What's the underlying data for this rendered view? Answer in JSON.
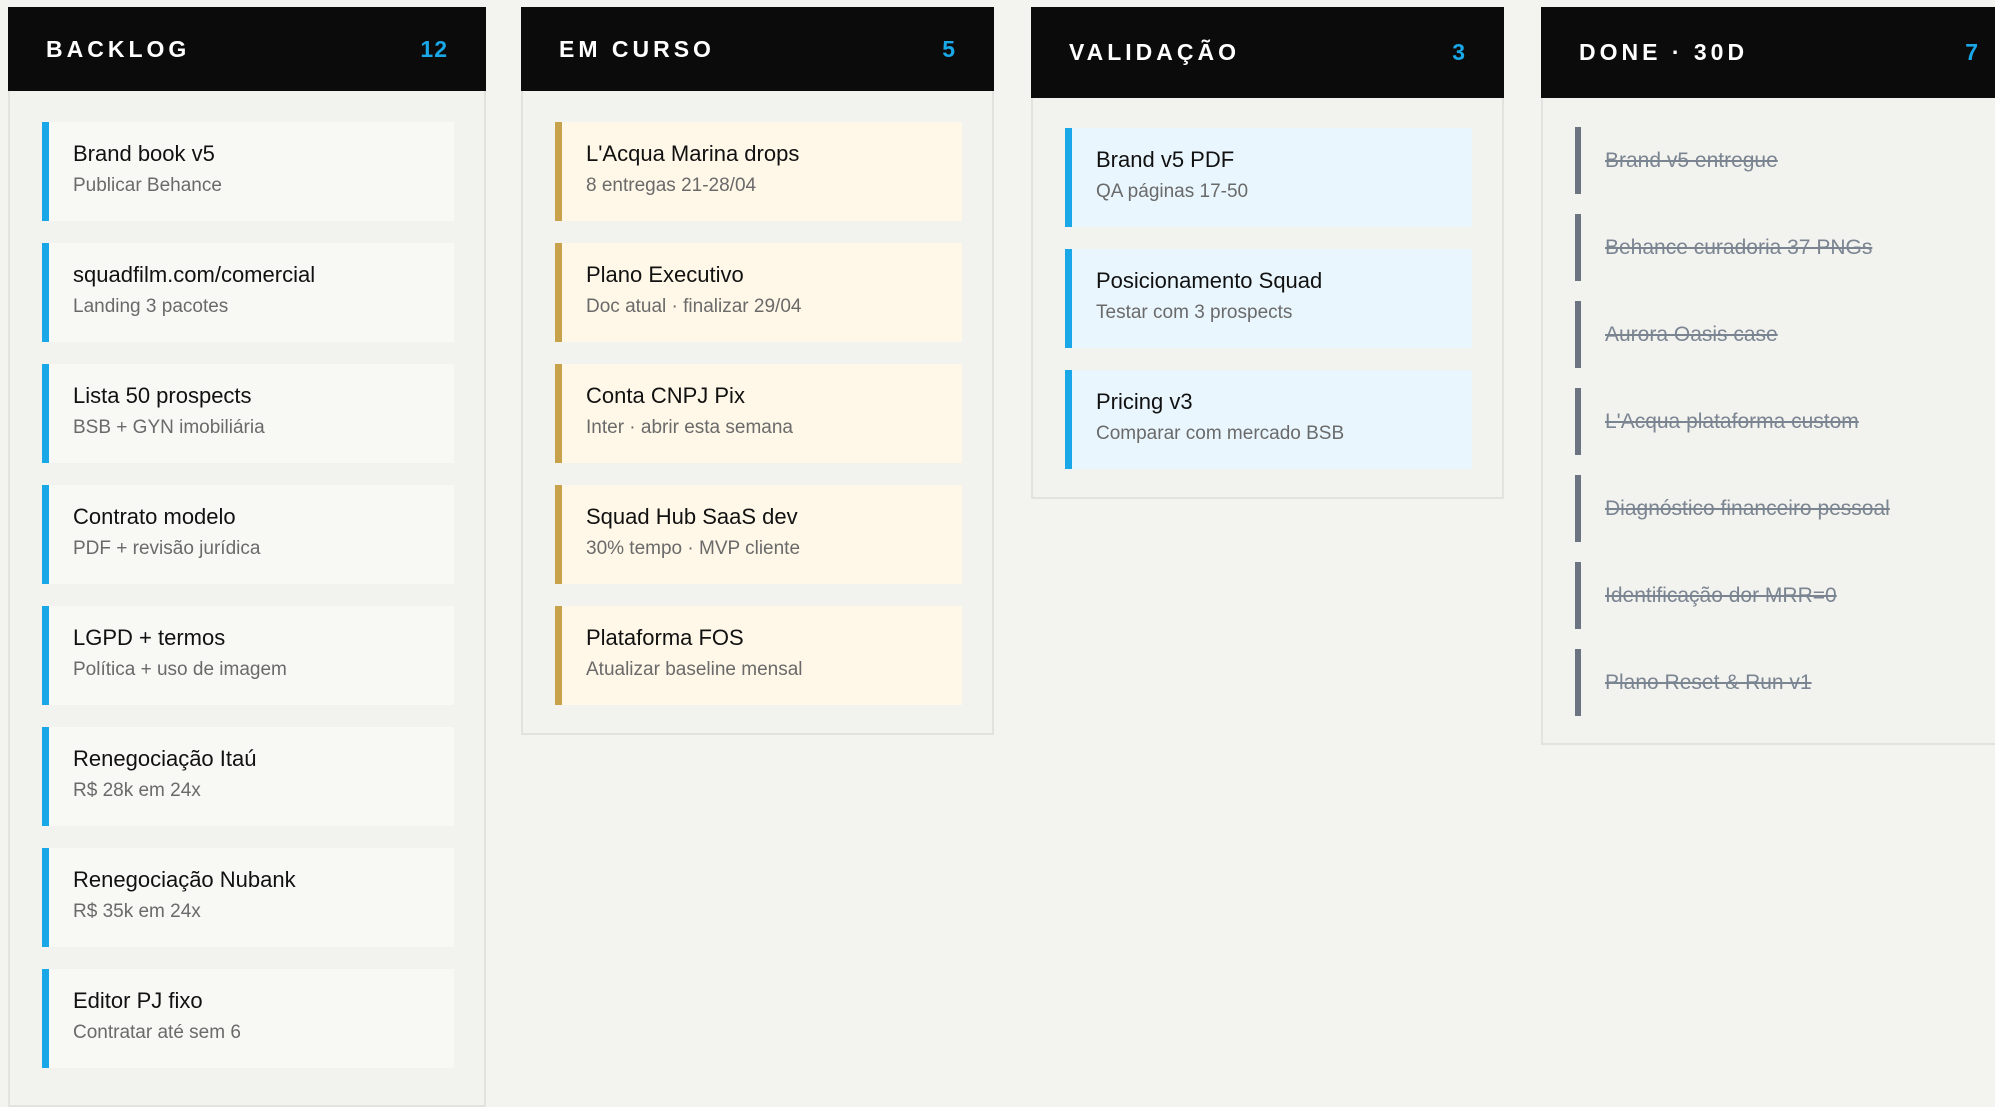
{
  "colors": {
    "page_bg": "#f3f3ef",
    "column_bg": "#f2f2ee",
    "column_border": "#e2e2de",
    "header_bg": "#0b0b0b",
    "header_text": "#ffffff",
    "count_accent": "#19a7e8",
    "backlog_card_bg": "#f8f8f5",
    "backlog_accent": "#19a7e8",
    "emcurso_card_bg": "#fff8e8",
    "emcurso_accent": "#c8a24a",
    "validacao_card_bg": "#e9f6fd",
    "validacao_accent": "#19a7e8",
    "done_accent": "#6b7480",
    "done_text": "#7b8592"
  },
  "columns": [
    {
      "id": "backlog",
      "title": "BACKLOG",
      "count": "12",
      "cards": [
        {
          "title": "Brand book v5",
          "subtitle": "Publicar Behance"
        },
        {
          "title": "squadfilm.com/comercial",
          "subtitle": "Landing 3 pacotes"
        },
        {
          "title": "Lista 50 prospects",
          "subtitle": "BSB + GYN imobiliária"
        },
        {
          "title": "Contrato modelo",
          "subtitle": "PDF + revisão jurídica"
        },
        {
          "title": "LGPD + termos",
          "subtitle": "Política + uso de imagem"
        },
        {
          "title": "Renegociação Itaú",
          "subtitle": "R$ 28k em 24x"
        },
        {
          "title": "Renegociação Nubank",
          "subtitle": "R$ 35k em 24x"
        },
        {
          "title": "Editor PJ fixo",
          "subtitle": "Contratar até sem 6"
        }
      ]
    },
    {
      "id": "em-curso",
      "title": "EM CURSO",
      "count": "5",
      "cards": [
        {
          "title": "L'Acqua Marina drops",
          "subtitle": "8 entregas 21-28/04"
        },
        {
          "title": "Plano Executivo",
          "subtitle": "Doc atual · finalizar 29/04"
        },
        {
          "title": "Conta CNPJ Pix",
          "subtitle": "Inter · abrir esta semana"
        },
        {
          "title": "Squad Hub SaaS dev",
          "subtitle": "30% tempo · MVP cliente"
        },
        {
          "title": "Plataforma FOS",
          "subtitle": "Atualizar baseline mensal"
        }
      ]
    },
    {
      "id": "validacao",
      "title": "VALIDAÇÃO",
      "count": "3",
      "cards": [
        {
          "title": "Brand v5 PDF",
          "subtitle": "QA páginas 17-50"
        },
        {
          "title": "Posicionamento Squad",
          "subtitle": "Testar com 3 prospects"
        },
        {
          "title": "Pricing v3",
          "subtitle": "Comparar com mercado BSB"
        }
      ]
    },
    {
      "id": "done",
      "title": "DONE · 30D",
      "count": "7",
      "items": [
        "Brand v5 entregue",
        "Behance curadoria 37 PNGs",
        "Aurora Oasis case",
        "L'Acqua plataforma custom",
        "Diagnóstico financeiro pessoal",
        "Identificação dor MRR=0",
        "Plano Reset & Run v1"
      ]
    }
  ]
}
